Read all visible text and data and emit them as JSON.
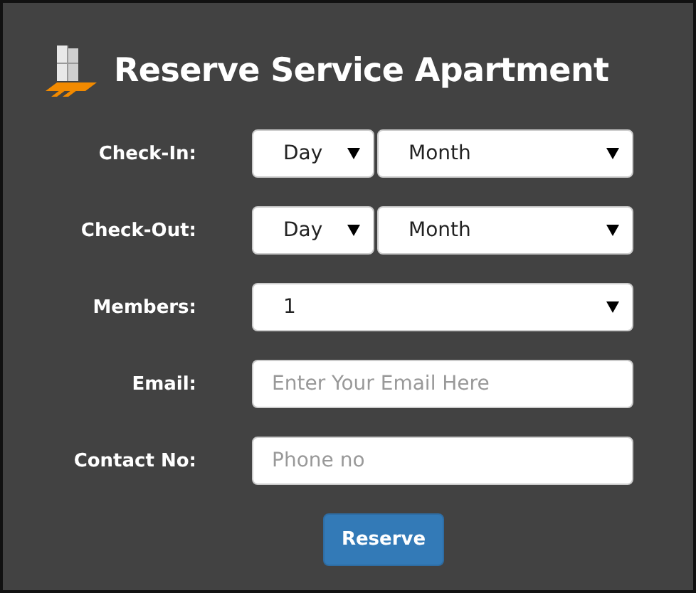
{
  "title": "Reserve Service Apartment",
  "fields": [
    {
      "label": "Check-In:",
      "kind": "selects",
      "selects": [
        "Day",
        "Month"
      ]
    },
    {
      "label": "Check-Out:",
      "kind": "selects",
      "selects": [
        "Day",
        "Month"
      ]
    },
    {
      "label": "Members:",
      "kind": "selects",
      "selects": [
        "1"
      ]
    },
    {
      "label": "Email:",
      "kind": "input",
      "placeholder": "Enter Your Email Here"
    },
    {
      "label": "Contact No:",
      "kind": "input",
      "placeholder": "Phone no"
    }
  ],
  "button": "Reserve"
}
